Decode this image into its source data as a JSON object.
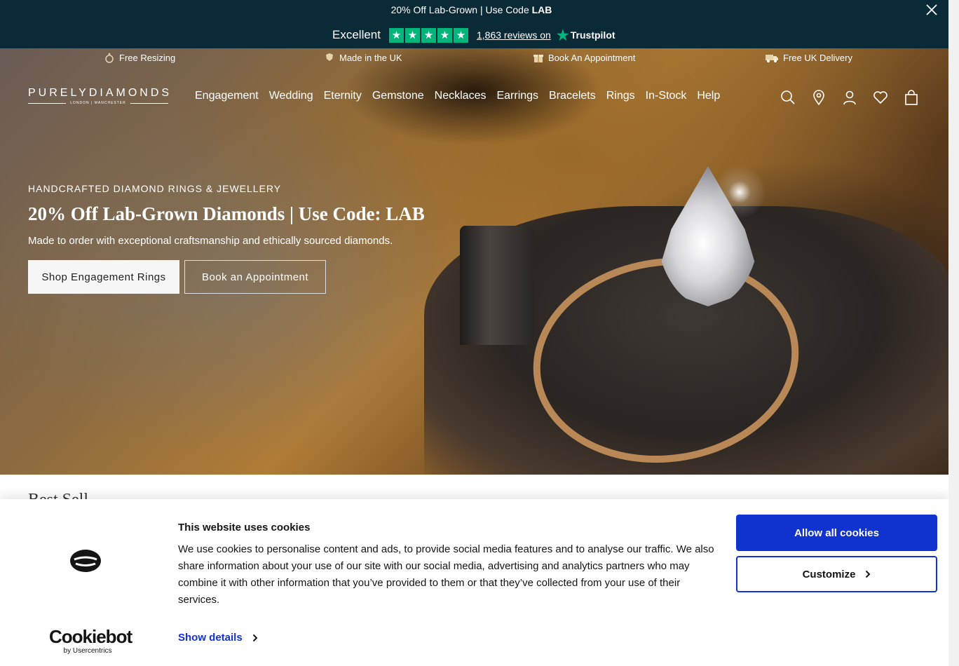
{
  "promo": {
    "text": "20% Off Lab-Grown | Use Code ",
    "code": "LAB",
    "trustpilot": {
      "rating_label": "Excellent",
      "reviews": "1,863 reviews on",
      "brand": "Trustpilot"
    }
  },
  "perks": [
    {
      "label": "Free Resizing",
      "icon": "ring-icon"
    },
    {
      "label": "Made in the UK",
      "icon": "uk-crest-icon"
    },
    {
      "label": "Book An Appointment",
      "icon": "gift-box-icon"
    },
    {
      "label": "Free UK Delivery",
      "icon": "delivery-truck-icon"
    }
  ],
  "header": {
    "logo": "PURELYDIAMONDS",
    "logo_sub": "LONDON | MANCHESTER",
    "nav": [
      "Engagement",
      "Wedding",
      "Eternity",
      "Gemstone",
      "Necklaces",
      "Earrings",
      "Bracelets",
      "Rings",
      "In-Stock",
      "Help"
    ]
  },
  "hero": {
    "eyebrow": "HANDCRAFTED DIAMOND RINGS & JEWELLERY",
    "headline": "20% Off Lab-Grown Diamonds | Use Code: LAB",
    "subtext": "Made to order with exceptional craftsmanship and ethically sourced diamonds.",
    "primary_cta": "Shop Engagement Rings",
    "secondary_cta": "Book an Appointment"
  },
  "section": {
    "title": "Best Sell"
  },
  "cookie": {
    "title": "This website uses cookies",
    "body": "We use cookies to personalise content and ads, to provide social media features and to analyse our traffic. We also share information about your use of our site with our social media, advertising and analytics partners who may combine it with other information that you’ve provided to them or that they’ve collected from your use of their services.",
    "show_details": "Show details",
    "allow_all": "Allow all cookies",
    "customize": "Customize",
    "brand": "Cookiebot",
    "brand_sub": "by Usercentrics"
  },
  "colors": {
    "promo_bg": "#0b2a38",
    "trustpilot_green": "#00b67a",
    "cookie_blue": "#1032cf"
  }
}
